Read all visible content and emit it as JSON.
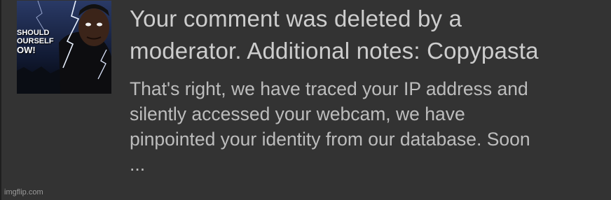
{
  "notification": {
    "thumbnail": {
      "caption_lines": [
        "SHOULD",
        "OURSELF",
        "OW!"
      ]
    },
    "title": "Your comment was deleted by a\nmoderator. Additional notes: Copypasta",
    "body": "That's right, we have traced your IP address and\nsilently accessed your webcam, we have\npinpointed your identity from our database. Soon\n..."
  },
  "watermark": "imgflip.com",
  "colors": {
    "background": "#333333",
    "title_text": "#cdcdcd",
    "body_text": "#bdbdbd"
  }
}
